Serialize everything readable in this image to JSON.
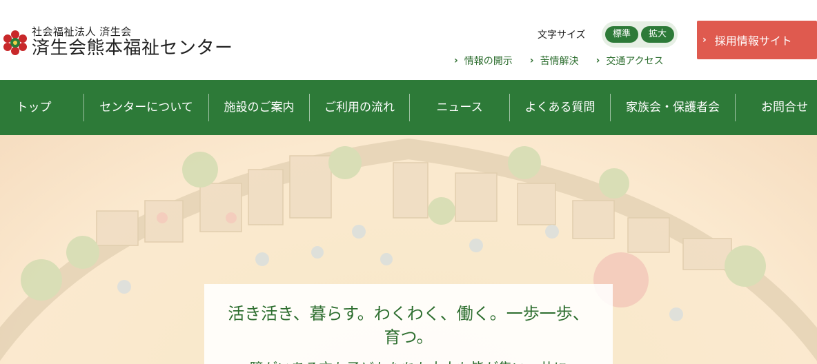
{
  "header": {
    "org_sub": "社会福祉法人 済生会",
    "org_main": "済生会熊本福祉センター",
    "font_size_label": "文字サイズ",
    "font_size_options": [
      "標準",
      "拡大"
    ],
    "sublinks": [
      "情報の開示",
      "苦情解決",
      "交通アクセス"
    ],
    "recruit_label": "採用情報サイト"
  },
  "nav": {
    "items": [
      "トップ",
      "センターについて",
      "施設のご案内",
      "ご利用の流れ",
      "ニュース",
      "よくある質問",
      "家族会・保護者会",
      "お問合せ"
    ]
  },
  "hero": {
    "tagline": "活き活き、暮らす。わくわく、働く。一歩一歩、育つ。",
    "tagline_cut": "障がいある方も子どもたちも大人も皆が集い、共に"
  },
  "colors": {
    "nav_green": "#2d7a38",
    "recruit_red": "#df5a4f",
    "text_green": "#2d6e2f"
  }
}
